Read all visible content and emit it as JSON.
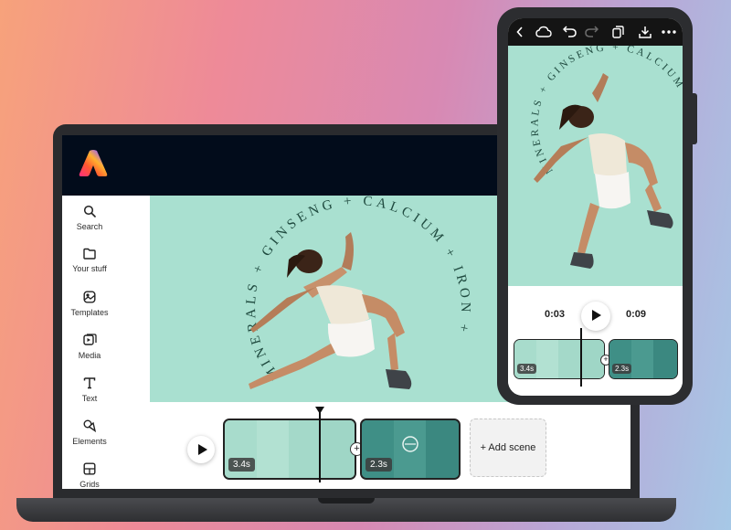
{
  "sidebar": {
    "items": [
      {
        "label": "Search",
        "icon": "search-icon"
      },
      {
        "label": "Your stuff",
        "icon": "folder-icon"
      },
      {
        "label": "Templates",
        "icon": "templates-icon"
      },
      {
        "label": "Media",
        "icon": "media-icon"
      },
      {
        "label": "Text",
        "icon": "text-icon"
      },
      {
        "label": "Elements",
        "icon": "elements-icon"
      },
      {
        "label": "Grids",
        "icon": "grids-icon"
      }
    ]
  },
  "canvas": {
    "arc_words": [
      "MINERALS",
      "+",
      "GINSENG",
      "+",
      "CALCIUM",
      "+",
      "IRON",
      "+"
    ]
  },
  "timeline": {
    "scenes": [
      {
        "duration": "3.4s"
      },
      {
        "duration": "2.3s"
      }
    ],
    "add_scene_label": "+ Add scene",
    "join_symbol": "+"
  },
  "phone": {
    "current_time": "0:03",
    "total_time": "0:09",
    "scenes": [
      {
        "duration": "3.4s"
      },
      {
        "duration": "2.3s"
      }
    ],
    "join_symbol": "+"
  },
  "colors": {
    "canvas_bg": "#a9e0d0",
    "topbar_bg": "#020c1b",
    "text_arc": "#1f4a3f"
  }
}
